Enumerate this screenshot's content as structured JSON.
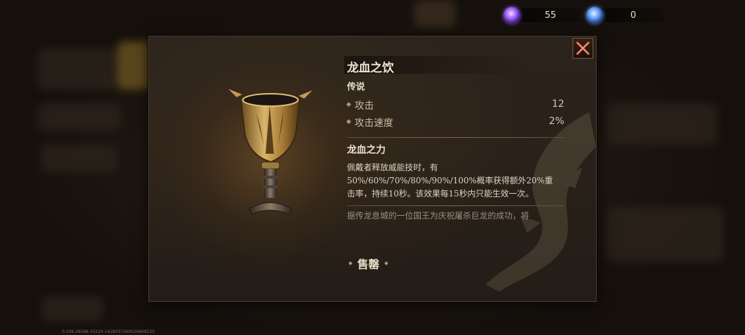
{
  "currencies": [
    {
      "icon": "purple-crystal-icon",
      "value": "55"
    },
    {
      "icon": "blue-crystal-icon",
      "value": "0"
    }
  ],
  "item": {
    "name": "龙血之饮",
    "rarity": "传说",
    "stats": [
      {
        "label": "攻击",
        "value": "12"
      },
      {
        "label": "攻击速度",
        "value": "2%"
      }
    ],
    "skill_title": "龙血之力",
    "skill_desc_lines": [
      "佩戴者释放威能技时，有",
      "50%/60%/70%/80%/90%/100%概率获得额外20%重",
      "击率，持续10秒。该效果每15秒内只能生效一次。"
    ],
    "lore": "据传龙息城的一位国王为庆祝屠杀巨龙的成功，将"
  },
  "actions": {
    "sell_label": "售罄",
    "close_icon": "close-x-icon"
  },
  "footer": {
    "version": "0.206.29588-33220-1428037360529669120"
  },
  "colors": {
    "panel_bg": "#2a221b",
    "title_text": "#efe6d4",
    "accent_gold": "#a89676",
    "close_red": "#c9543a"
  }
}
